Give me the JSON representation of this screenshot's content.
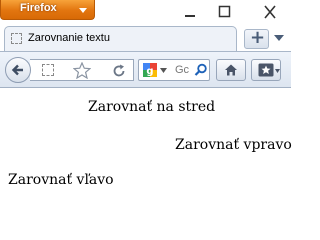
{
  "window": {
    "app_button_label": "Firefox",
    "tab_title": "Zarovnanie textu",
    "search_placeholder": "Gc"
  },
  "page": {
    "lines": [
      {
        "text": "Zarovnať na stred",
        "align": "center"
      },
      {
        "text": "Zarovnať vpravo",
        "align": "right"
      },
      {
        "text": "Zarovnať vľavo",
        "align": "left"
      }
    ]
  },
  "colors": {
    "firefox_button": "#e2750f",
    "toolbar": "#dde5f0",
    "tab": "#eef2f8"
  }
}
